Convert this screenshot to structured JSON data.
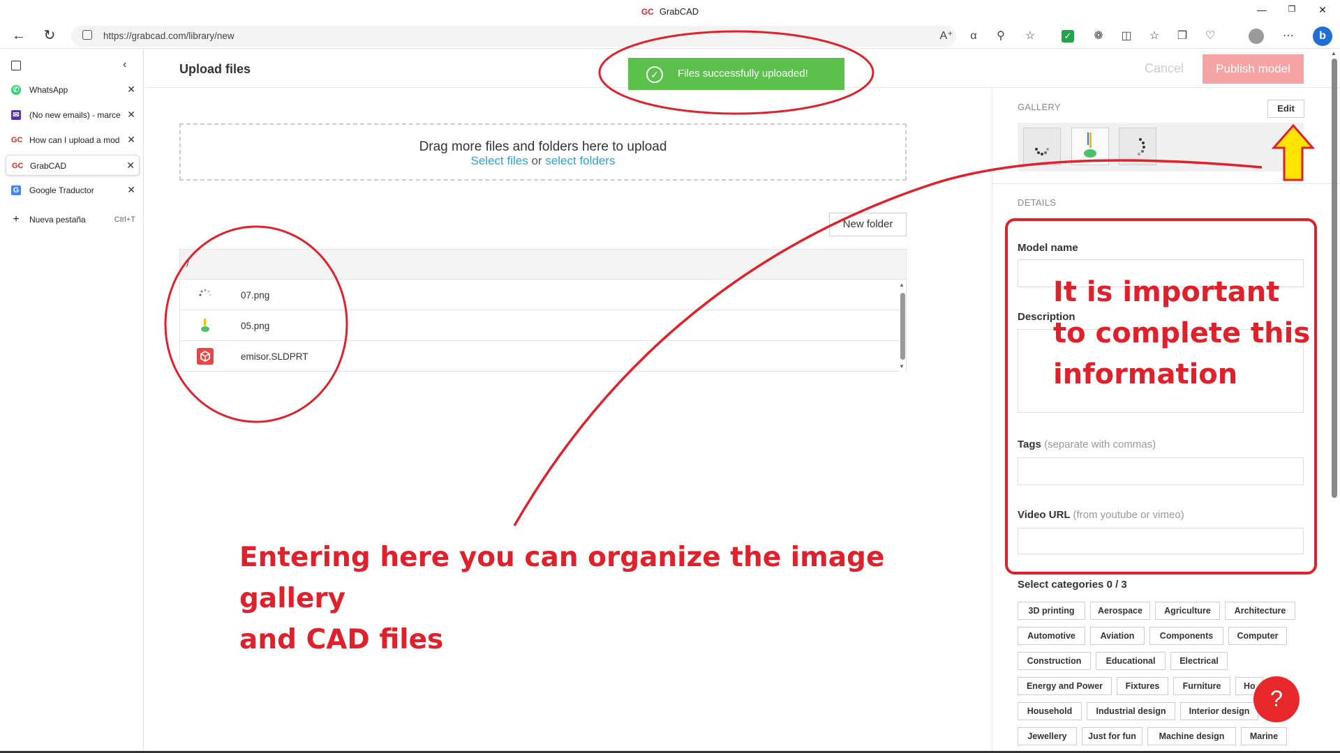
{
  "browser": {
    "window_title_logo": "GC",
    "window_title": "GrabCAD",
    "url": "https://grabcad.com/library/new",
    "tabs": [
      {
        "icon": "whatsapp-icon",
        "label": "WhatsApp"
      },
      {
        "icon": "mail-icon",
        "label": "(No new emails) - marce"
      },
      {
        "icon": "grabcad-icon",
        "label": "How can I upload a mod"
      },
      {
        "icon": "grabcad-icon",
        "label": "GrabCAD"
      },
      {
        "icon": "translate-icon",
        "label": "Google Traductor"
      }
    ],
    "new_tab_label": "Nueva pestaña",
    "new_tab_shortcut": "Ctrl+T"
  },
  "page": {
    "title": "Upload files",
    "cancel_label": "Cancel",
    "publish_label": "Publish model",
    "toast": "Files successfully uploaded!",
    "dropzone": {
      "text": "Drag more files and folders here to upload",
      "select_files": "Select files",
      "or": "or",
      "select_folders": "select folders"
    },
    "new_folder_label": "New folder",
    "path_marker": "/",
    "files": [
      {
        "name": "07.png",
        "icon": "loading-spinner-icon"
      },
      {
        "name": "05.png",
        "icon": "image-thumbnail-icon"
      },
      {
        "name": "emisor.SLDPRT",
        "icon": "cad-part-icon"
      }
    ]
  },
  "panel": {
    "gallery_heading": "GALLERY",
    "edit_label": "Edit",
    "details_heading": "DETAILS",
    "model_name_label": "Model name",
    "description_label": "Description",
    "tags_label": "Tags",
    "tags_hint": "(separate with commas)",
    "video_label": "Video URL",
    "video_hint": "(from youtube or vimeo)",
    "categories_label": "Select categories 0 / 3",
    "categories": [
      [
        "3D printing",
        "Aerospace",
        "Agriculture",
        "Architecture"
      ],
      [
        "Automotive",
        "Aviation",
        "Components",
        "Computer"
      ],
      [
        "Construction",
        "Educational",
        "Electrical"
      ],
      [
        "Energy and Power",
        "Fixtures",
        "Furniture",
        "Ho"
      ],
      [
        "Household",
        "Industrial design",
        "Interior design"
      ],
      [
        "Jewellery",
        "Just for fun",
        "Machine design",
        "Marine"
      ]
    ],
    "help_label": "?"
  },
  "annotations": {
    "panel_note": [
      "It is important",
      "to complete this",
      "information"
    ],
    "gallery_note": [
      "Entering here you can organize the image gallery",
      "and CAD files"
    ]
  },
  "colors": {
    "annotation": "#e0202a",
    "toast": "#5cc04d",
    "publish": "#f5a3a3",
    "link": "#2ba3d6"
  }
}
